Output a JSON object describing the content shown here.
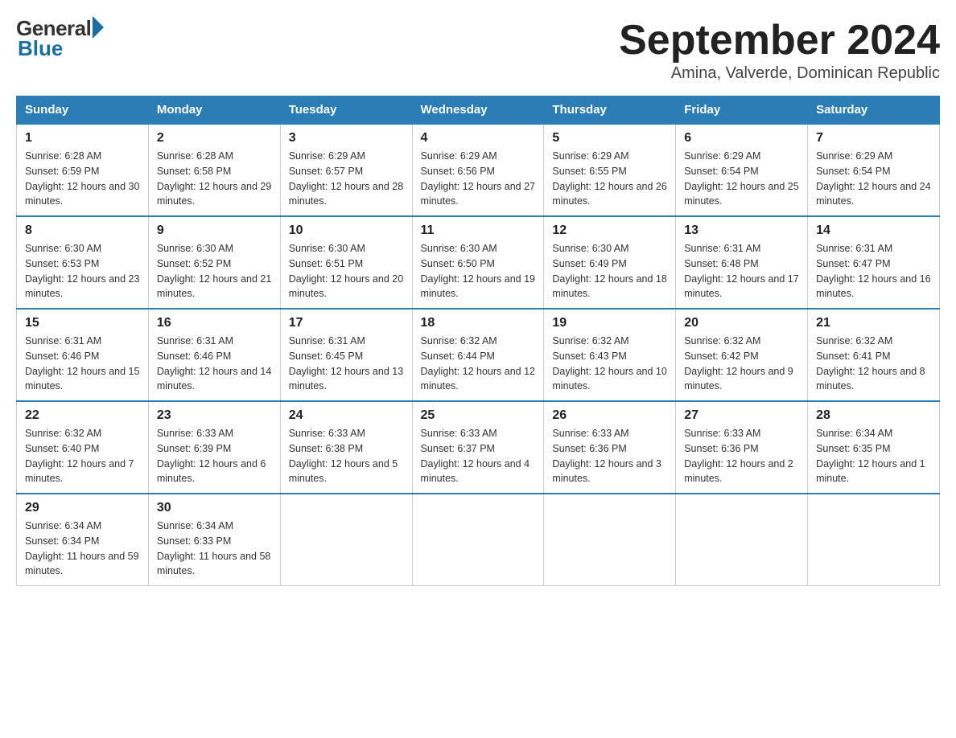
{
  "logo": {
    "general": "General",
    "blue": "Blue"
  },
  "title": {
    "month": "September 2024",
    "location": "Amina, Valverde, Dominican Republic"
  },
  "headers": [
    "Sunday",
    "Monday",
    "Tuesday",
    "Wednesday",
    "Thursday",
    "Friday",
    "Saturday"
  ],
  "weeks": [
    [
      {
        "day": "1",
        "sunrise": "6:28 AM",
        "sunset": "6:59 PM",
        "daylight": "12 hours and 30 minutes."
      },
      {
        "day": "2",
        "sunrise": "6:28 AM",
        "sunset": "6:58 PM",
        "daylight": "12 hours and 29 minutes."
      },
      {
        "day": "3",
        "sunrise": "6:29 AM",
        "sunset": "6:57 PM",
        "daylight": "12 hours and 28 minutes."
      },
      {
        "day": "4",
        "sunrise": "6:29 AM",
        "sunset": "6:56 PM",
        "daylight": "12 hours and 27 minutes."
      },
      {
        "day": "5",
        "sunrise": "6:29 AM",
        "sunset": "6:55 PM",
        "daylight": "12 hours and 26 minutes."
      },
      {
        "day": "6",
        "sunrise": "6:29 AM",
        "sunset": "6:54 PM",
        "daylight": "12 hours and 25 minutes."
      },
      {
        "day": "7",
        "sunrise": "6:29 AM",
        "sunset": "6:54 PM",
        "daylight": "12 hours and 24 minutes."
      }
    ],
    [
      {
        "day": "8",
        "sunrise": "6:30 AM",
        "sunset": "6:53 PM",
        "daylight": "12 hours and 23 minutes."
      },
      {
        "day": "9",
        "sunrise": "6:30 AM",
        "sunset": "6:52 PM",
        "daylight": "12 hours and 21 minutes."
      },
      {
        "day": "10",
        "sunrise": "6:30 AM",
        "sunset": "6:51 PM",
        "daylight": "12 hours and 20 minutes."
      },
      {
        "day": "11",
        "sunrise": "6:30 AM",
        "sunset": "6:50 PM",
        "daylight": "12 hours and 19 minutes."
      },
      {
        "day": "12",
        "sunrise": "6:30 AM",
        "sunset": "6:49 PM",
        "daylight": "12 hours and 18 minutes."
      },
      {
        "day": "13",
        "sunrise": "6:31 AM",
        "sunset": "6:48 PM",
        "daylight": "12 hours and 17 minutes."
      },
      {
        "day": "14",
        "sunrise": "6:31 AM",
        "sunset": "6:47 PM",
        "daylight": "12 hours and 16 minutes."
      }
    ],
    [
      {
        "day": "15",
        "sunrise": "6:31 AM",
        "sunset": "6:46 PM",
        "daylight": "12 hours and 15 minutes."
      },
      {
        "day": "16",
        "sunrise": "6:31 AM",
        "sunset": "6:46 PM",
        "daylight": "12 hours and 14 minutes."
      },
      {
        "day": "17",
        "sunrise": "6:31 AM",
        "sunset": "6:45 PM",
        "daylight": "12 hours and 13 minutes."
      },
      {
        "day": "18",
        "sunrise": "6:32 AM",
        "sunset": "6:44 PM",
        "daylight": "12 hours and 12 minutes."
      },
      {
        "day": "19",
        "sunrise": "6:32 AM",
        "sunset": "6:43 PM",
        "daylight": "12 hours and 10 minutes."
      },
      {
        "day": "20",
        "sunrise": "6:32 AM",
        "sunset": "6:42 PM",
        "daylight": "12 hours and 9 minutes."
      },
      {
        "day": "21",
        "sunrise": "6:32 AM",
        "sunset": "6:41 PM",
        "daylight": "12 hours and 8 minutes."
      }
    ],
    [
      {
        "day": "22",
        "sunrise": "6:32 AM",
        "sunset": "6:40 PM",
        "daylight": "12 hours and 7 minutes."
      },
      {
        "day": "23",
        "sunrise": "6:33 AM",
        "sunset": "6:39 PM",
        "daylight": "12 hours and 6 minutes."
      },
      {
        "day": "24",
        "sunrise": "6:33 AM",
        "sunset": "6:38 PM",
        "daylight": "12 hours and 5 minutes."
      },
      {
        "day": "25",
        "sunrise": "6:33 AM",
        "sunset": "6:37 PM",
        "daylight": "12 hours and 4 minutes."
      },
      {
        "day": "26",
        "sunrise": "6:33 AM",
        "sunset": "6:36 PM",
        "daylight": "12 hours and 3 minutes."
      },
      {
        "day": "27",
        "sunrise": "6:33 AM",
        "sunset": "6:36 PM",
        "daylight": "12 hours and 2 minutes."
      },
      {
        "day": "28",
        "sunrise": "6:34 AM",
        "sunset": "6:35 PM",
        "daylight": "12 hours and 1 minute."
      }
    ],
    [
      {
        "day": "29",
        "sunrise": "6:34 AM",
        "sunset": "6:34 PM",
        "daylight": "11 hours and 59 minutes."
      },
      {
        "day": "30",
        "sunrise": "6:34 AM",
        "sunset": "6:33 PM",
        "daylight": "11 hours and 58 minutes."
      },
      null,
      null,
      null,
      null,
      null
    ]
  ],
  "labels": {
    "sunrise": "Sunrise:",
    "sunset": "Sunset:",
    "daylight": "Daylight:"
  }
}
